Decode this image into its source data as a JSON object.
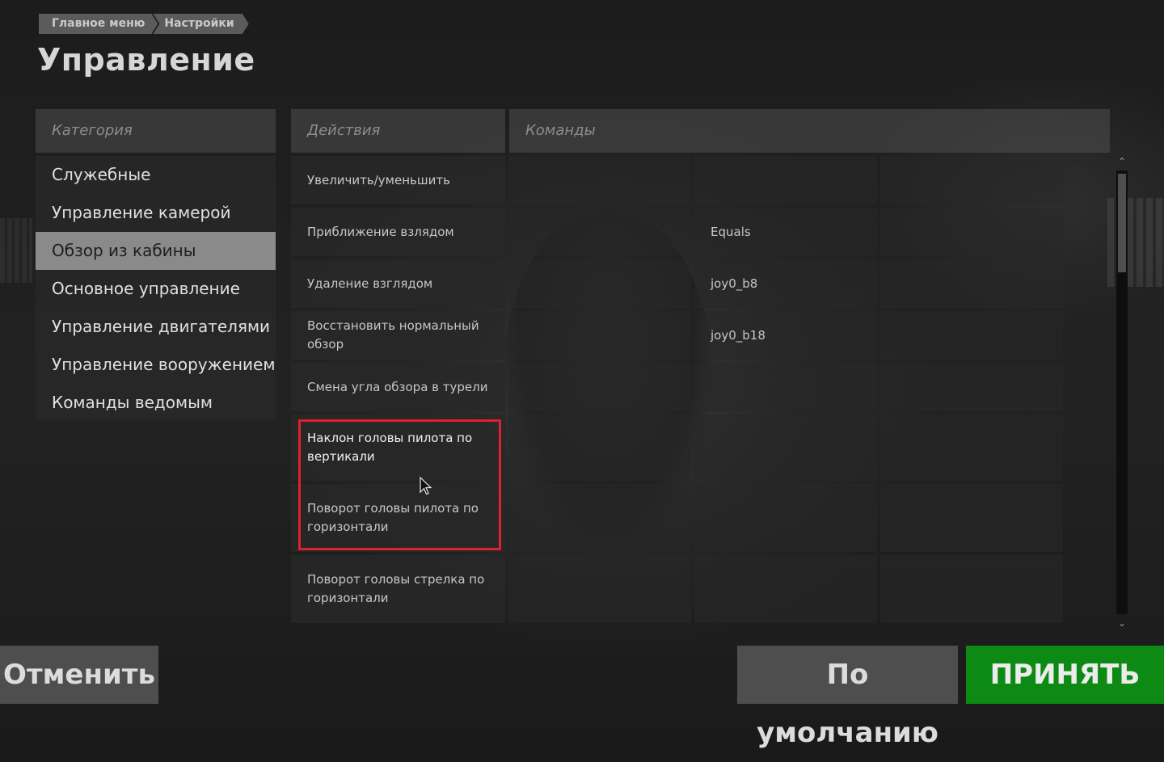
{
  "breadcrumb": {
    "items": [
      "Главное меню",
      "Настройки"
    ]
  },
  "page": {
    "title": "Управление"
  },
  "categories": {
    "header": "Категория",
    "items": [
      {
        "label": "Служебные",
        "active": false
      },
      {
        "label": "Управление камерой",
        "active": false
      },
      {
        "label": "Обзор из кабины",
        "active": true
      },
      {
        "label": "Основное управление",
        "active": false
      },
      {
        "label": "Управление двигателями",
        "active": false
      },
      {
        "label": "Управление вооружением",
        "active": false
      },
      {
        "label": "Команды ведомым",
        "active": false
      }
    ]
  },
  "table": {
    "actions_header": "Действия",
    "commands_header": "Команды",
    "rows": [
      {
        "action": "Увеличить/уменьшить",
        "cmd1": "",
        "cmd2": "",
        "cmd3": ""
      },
      {
        "action": "Приближение взлядом",
        "cmd1": "",
        "cmd2": "Equals",
        "cmd3": ""
      },
      {
        "action": "Удаление взглядом",
        "cmd1": "",
        "cmd2": "joy0_b8",
        "cmd3": ""
      },
      {
        "action": "Восстановить нормальный обзор",
        "cmd1": "",
        "cmd2": "joy0_b18",
        "cmd3": ""
      },
      {
        "action": "Смена угла обзора в турели",
        "cmd1": "",
        "cmd2": "",
        "cmd3": ""
      },
      {
        "action": "Наклон головы пилота по вертикали",
        "cmd1": "",
        "cmd2": "",
        "cmd3": ""
      },
      {
        "action": "Поворот головы пилота по горизонтали",
        "cmd1": "",
        "cmd2": "",
        "cmd3": ""
      },
      {
        "action": "Поворот головы стрелка по горизонтали",
        "cmd1": "",
        "cmd2": "",
        "cmd3": ""
      }
    ]
  },
  "scrollbar": {
    "position_fraction": 0.0
  },
  "buttons": {
    "cancel": "Отменить",
    "default": "По умолчанию",
    "accept": "ПРИНЯТЬ"
  },
  "colors": {
    "accept": "#0d8a13",
    "highlight_border": "#e0202a",
    "active_category": "#8a8a8a"
  }
}
